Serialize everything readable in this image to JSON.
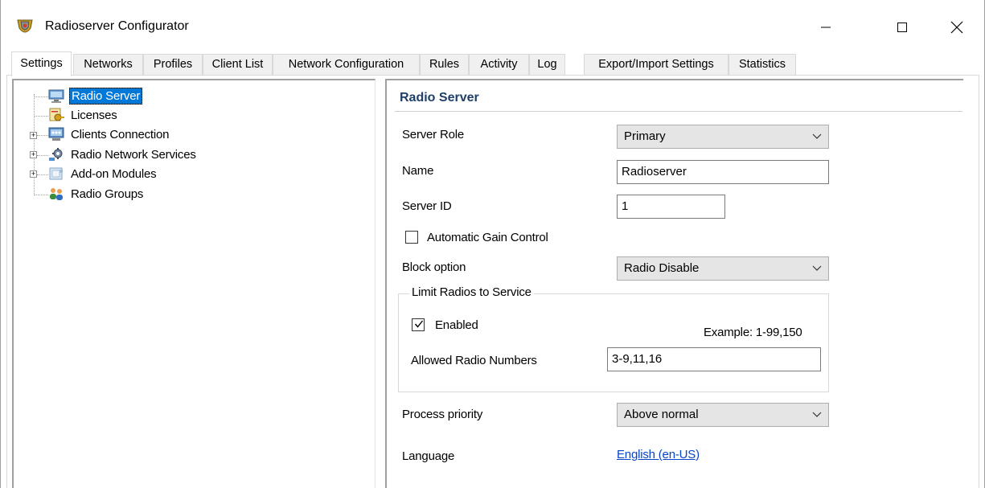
{
  "window": {
    "title": "Radioserver Configurator",
    "icon": "radioserver-app-icon"
  },
  "tabs": [
    {
      "label": "Settings",
      "active": true
    },
    {
      "label": "Networks",
      "active": false
    },
    {
      "label": "Profiles",
      "active": false
    },
    {
      "label": "Client List",
      "active": false
    },
    {
      "label": "Network Configuration",
      "active": false
    },
    {
      "label": "Rules",
      "active": false
    },
    {
      "label": "Activity",
      "active": false
    },
    {
      "label": "Log",
      "active": false
    },
    {
      "label": "Export/Import Settings",
      "active": false
    },
    {
      "label": "Statistics",
      "active": false
    }
  ],
  "tree": [
    {
      "label": "Radio Server",
      "icon": "server-monitor-icon",
      "selected": true,
      "expandable": false
    },
    {
      "label": "Licenses",
      "icon": "key-icon",
      "selected": false,
      "expandable": false
    },
    {
      "label": "Clients Connection",
      "icon": "network-monitor-icon",
      "selected": false,
      "expandable": true
    },
    {
      "label": "Radio Network Services",
      "icon": "gear-network-icon",
      "selected": false,
      "expandable": true
    },
    {
      "label": "Add-on Modules",
      "icon": "module-icon",
      "selected": false,
      "expandable": true
    },
    {
      "label": "Radio Groups",
      "icon": "users-group-icon",
      "selected": false,
      "expandable": false
    }
  ],
  "panel": {
    "title": "Radio Server",
    "server_role": {
      "label": "Server Role",
      "value": "Primary"
    },
    "name": {
      "label": "Name",
      "value": "Radioserver"
    },
    "server_id": {
      "label": "Server ID",
      "value": "1"
    },
    "agc": {
      "label": "Automatic Gain Control",
      "checked": false
    },
    "block_option": {
      "label": "Block option",
      "value": "Radio Disable"
    },
    "limit_group": {
      "title": "Limit Radios to Service",
      "enabled": {
        "label": "Enabled",
        "checked": true
      },
      "example": "Example: 1-99,150",
      "allowed": {
        "label": "Allowed Radio Numbers",
        "value": "3-9,11,16"
      }
    },
    "process_priority": {
      "label": "Process priority",
      "value": "Above normal"
    },
    "language": {
      "label": "Language",
      "value": "English (en-US)"
    }
  },
  "colors": {
    "selection": "#0078d7",
    "section_title": "#1e3f66",
    "link": "#0645c8"
  }
}
